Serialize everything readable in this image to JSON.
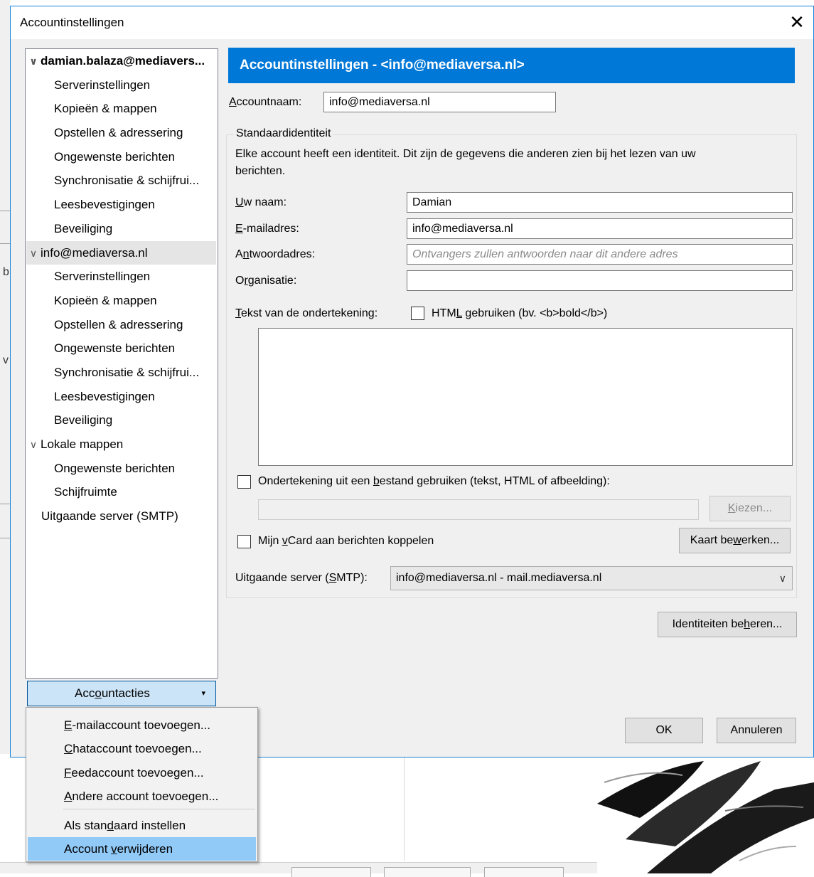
{
  "dialog": {
    "title": "Accountinstellingen",
    "close_glyph": "✕"
  },
  "tree": {
    "expand_glyph": "∨",
    "accounts": [
      {
        "name": "damian.balaza@mediavers...",
        "children": [
          "Serverinstellingen",
          "Kopieën & mappen",
          "Opstellen & adressering",
          "Ongewenste berichten",
          "Synchronisatie & schijfrui...",
          "Leesbevestigingen",
          "Beveiliging"
        ]
      },
      {
        "name": "info@mediaversa.nl",
        "children": [
          "Serverinstellingen",
          "Kopieën & mappen",
          "Opstellen & adressering",
          "Ongewenste berichten",
          "Synchronisatie & schijfrui...",
          "Leesbevestigingen",
          "Beveiliging"
        ]
      },
      {
        "name": "Lokale mappen",
        "children": [
          "Ongewenste berichten",
          "Schijfruimte"
        ]
      }
    ],
    "outgoing": "Uitgaande server (SMTP)"
  },
  "account_actions": {
    "pre": "Acc",
    "key": "o",
    "post": "untacties",
    "caret": "▾"
  },
  "menu": {
    "items": [
      {
        "pre": "",
        "key": "E",
        "post": "-mailaccount toevoegen..."
      },
      {
        "pre": "",
        "key": "C",
        "post": "hataccount toevoegen..."
      },
      {
        "pre": "",
        "key": "F",
        "post": "eedaccount toevoegen..."
      },
      {
        "pre": "",
        "key": "A",
        "post": "ndere account toevoegen..."
      },
      {
        "pre": "Als stan",
        "key": "d",
        "post": "aard instellen"
      },
      {
        "pre": "Account ",
        "key": "v",
        "post": "erwijderen"
      }
    ]
  },
  "main": {
    "banner": "Accountinstellingen - <info@mediaversa.nl>",
    "account_name": {
      "pre": "",
      "key": "A",
      "post": "ccountnaam:",
      "value": "info@mediaversa.nl"
    },
    "identity": {
      "legend": "Standaardidentiteit",
      "desc_line1": "Elke account heeft een identiteit. Dit zijn de gegevens die anderen zien bij het lezen van uw",
      "desc_line2": "berichten.",
      "your_name": {
        "pre": "",
        "key": "U",
        "post": "w naam:",
        "value": "Damian"
      },
      "email": {
        "pre": "",
        "key": "E",
        "post": "-mailadres:",
        "value": "info@mediaversa.nl"
      },
      "reply_to": {
        "pre": "A",
        "key": "n",
        "post": "twoordadres:",
        "placeholder": "Ontvangers zullen antwoorden naar dit andere adres"
      },
      "organization": {
        "pre": "O",
        "key": "r",
        "post": "ganisatie:",
        "value": ""
      },
      "signature_text": {
        "pre": "",
        "key": "T",
        "post": "ekst van de ondertekening:"
      },
      "use_html": {
        "pre": "HTM",
        "key": "L",
        "post": " gebruiken (bv. <b>bold</b>)"
      },
      "sig_file": {
        "pre": "Ondertekening uit een ",
        "key": "b",
        "post": "estand gebruiken (tekst, HTML of afbeelding):"
      },
      "choose": {
        "pre": "",
        "key": "K",
        "post": "iezen..."
      },
      "vcard": {
        "pre": "Mijn ",
        "key": "v",
        "post": "Card aan berichten koppelen"
      },
      "edit_card": {
        "pre": "Kaart be",
        "key": "w",
        "post": "erken..."
      },
      "smtp": {
        "pre": "Uitgaande server (",
        "key": "S",
        "post": "MTP):",
        "value": "info@mediaversa.nl - mail.mediaversa.nl"
      }
    },
    "manage_identities": {
      "pre": "Identiteiten be",
      "key": "h",
      "post": "eren..."
    }
  },
  "buttons": {
    "ok": "OK",
    "cancel": "Annuleren"
  },
  "colors": {
    "accent": "#0078d7",
    "selection": "#91c9f7",
    "button_focus": "#cce4f7"
  },
  "background": {
    "left_chars": [
      "b",
      "v"
    ]
  }
}
